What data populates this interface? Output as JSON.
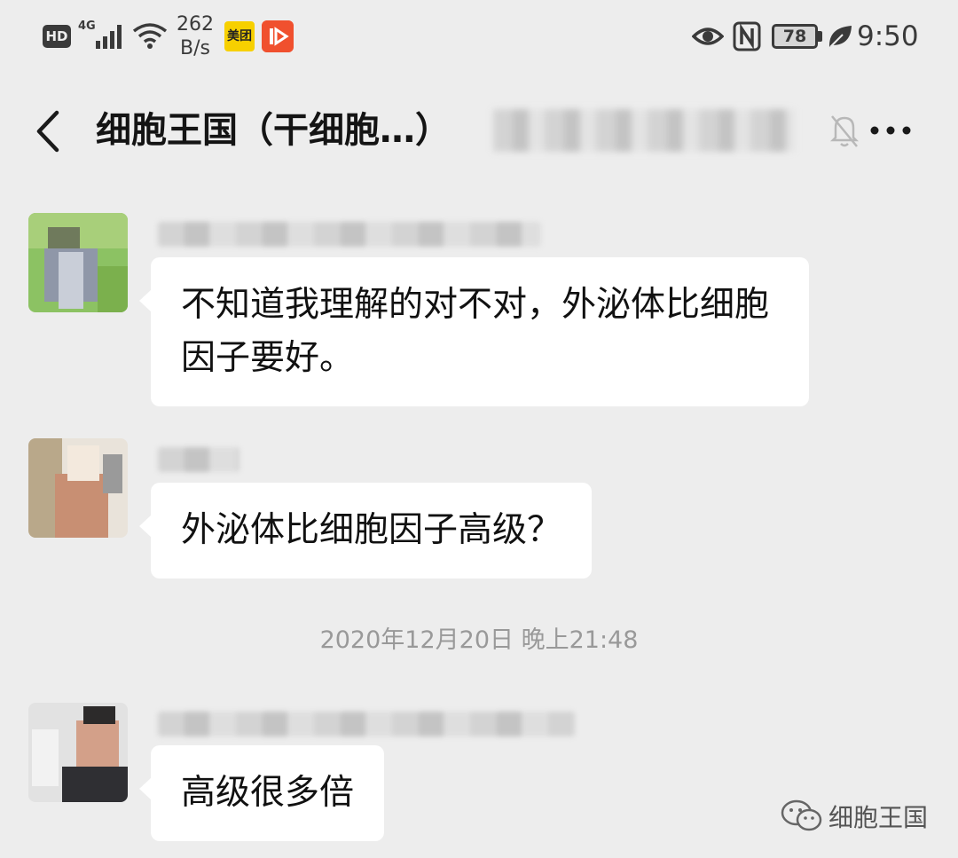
{
  "status_bar": {
    "hd": "HD",
    "network": "4G",
    "speed_value": "262",
    "speed_unit": "B/s",
    "app_badge_meituan": "美团",
    "battery": "78",
    "time": "9:50"
  },
  "header": {
    "title": "细胞王国（干细胞…）"
  },
  "messages": [
    {
      "text": "不知道我理解的对不对，外泌体比细胞因子要好。"
    },
    {
      "text": "外泌体比细胞因子高级？"
    },
    {
      "text": "高级很多倍"
    }
  ],
  "timestamp": "2020年12月20日 晚上21:48",
  "watermark": "细胞王国",
  "colors": {
    "background": "#ededed",
    "bubble": "#ffffff",
    "timestamp_text": "#999999"
  }
}
